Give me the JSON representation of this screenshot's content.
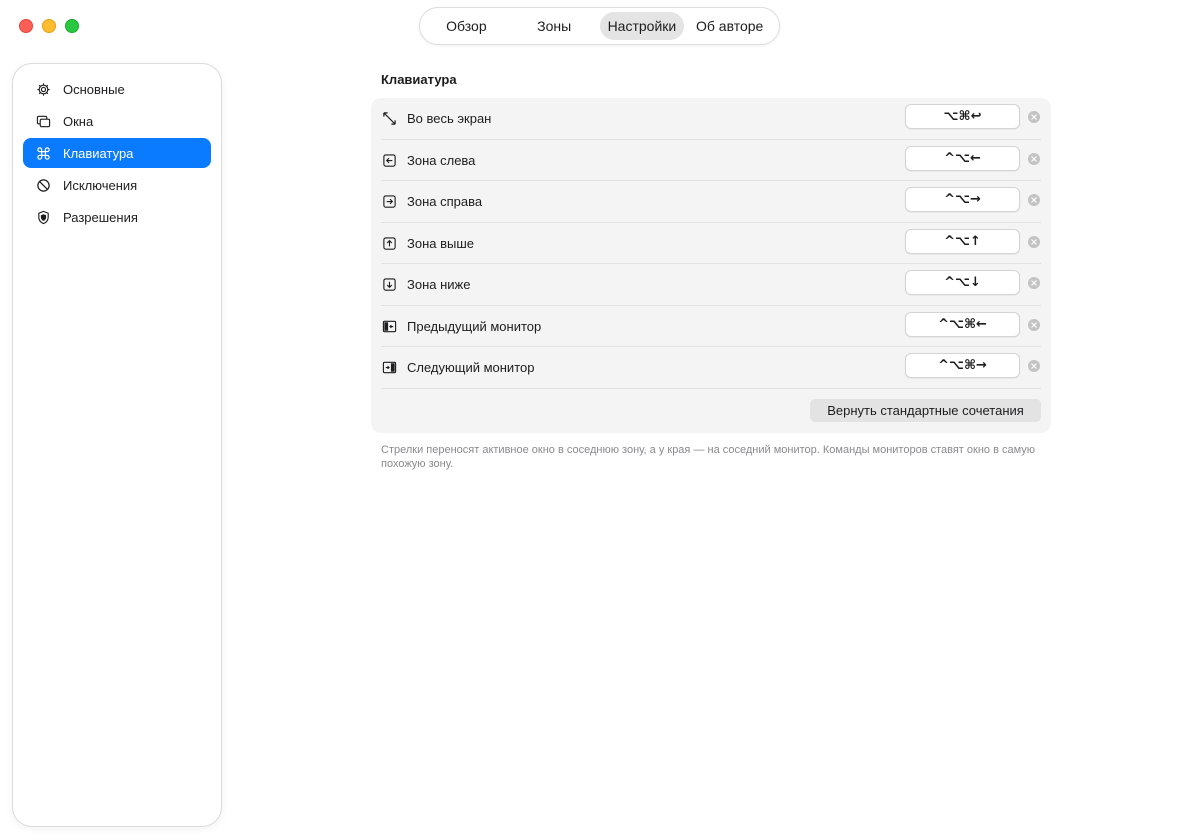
{
  "window": {
    "traffic_lights": [
      "close",
      "minimize",
      "zoom"
    ]
  },
  "tabs": [
    {
      "label": "Обзор",
      "active": false
    },
    {
      "label": "Зоны",
      "active": false
    },
    {
      "label": "Настройки",
      "active": true
    },
    {
      "label": "Об авторе",
      "active": false
    }
  ],
  "sidebar": {
    "items": [
      {
        "label": "Основные",
        "icon": "gear-icon",
        "active": false
      },
      {
        "label": "Окна",
        "icon": "windows-icon",
        "active": false
      },
      {
        "label": "Клавиатура",
        "icon": "command-icon",
        "active": true
      },
      {
        "label": "Исключения",
        "icon": "prohibited-icon",
        "active": false
      },
      {
        "label": "Разрешения",
        "icon": "shield-icon",
        "active": false
      }
    ]
  },
  "main": {
    "section_title": "Клавиатура",
    "shortcuts": [
      {
        "label": "Во весь экран",
        "icon": "fullscreen-arrows-icon",
        "keys": "⌥⌘↩"
      },
      {
        "label": "Зона слева",
        "icon": "arrow-left-square-icon",
        "keys": "^⌥←"
      },
      {
        "label": "Зона справа",
        "icon": "arrow-right-square-icon",
        "keys": "^⌥→"
      },
      {
        "label": "Зона выше",
        "icon": "arrow-up-square-icon",
        "keys": "^⌥↑"
      },
      {
        "label": "Зона ниже",
        "icon": "arrow-down-square-icon",
        "keys": "^⌥↓"
      },
      {
        "label": "Предыдущий монитор",
        "icon": "previous-monitor-icon",
        "keys": "^⌥⌘←"
      },
      {
        "label": "Следующий монитор",
        "icon": "next-monitor-icon",
        "keys": "^⌥⌘→"
      }
    ],
    "reset_label": "Вернуть стандартные сочетания",
    "footnote": "Стрелки переносят активное окно в соседнюю зону, а у края — на соседний монитор. Команды мониторов ставят окно в самую похожую зону."
  },
  "colors": {
    "accent": "#0a7aff",
    "panel_bg": "#f4f4f4",
    "close": "#ff5f57",
    "minimize": "#febc2e",
    "zoom": "#28c840"
  }
}
